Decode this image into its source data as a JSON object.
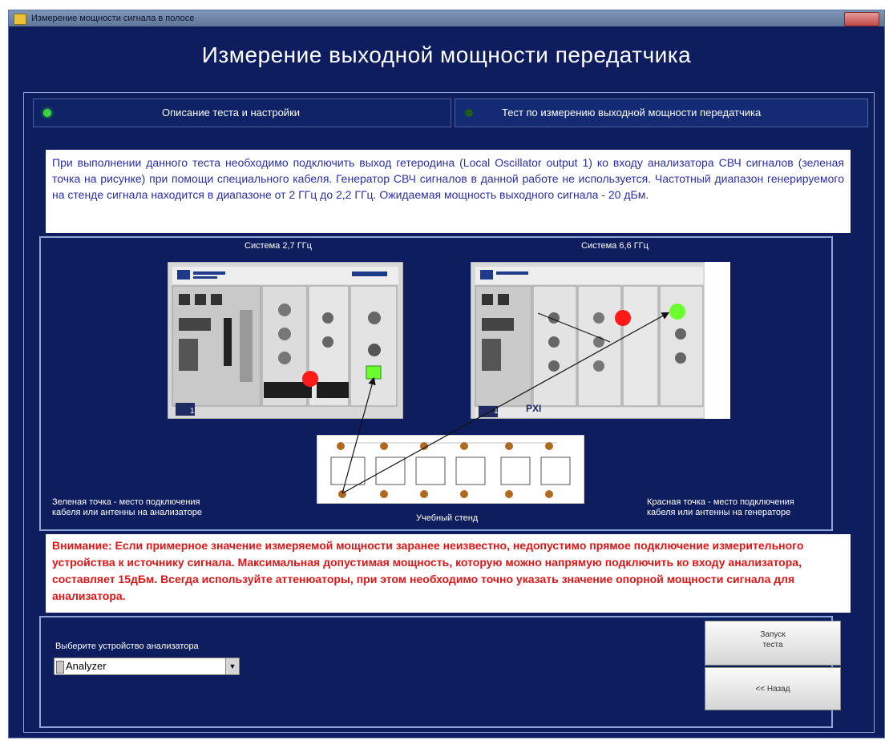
{
  "window": {
    "title": "Измерение мощности сигнала в полосе"
  },
  "header": {
    "title": "Измерение выходной мощности передатчика"
  },
  "tabs": [
    {
      "label": "Описание теста и настройки",
      "active": true
    },
    {
      "label": "Тест по измерению выходной мощности передатчика",
      "active": false
    }
  ],
  "description": "При выполнении данного теста необходимо подключить выход гетеродина (Local Oscillator output 1) ко входу анализатора СВЧ сигналов (зеленая точка на рисунке) при помощи специального кабеля. Генератор СВЧ сигналов в данной работе не используется. Частотный диапазон генерируемого на стенде сигнала находится в диапазоне от 2 ГГц до 2,2 ГГц. Ожидаемая мощность выходного сигнала - 20 дБм.",
  "figure": {
    "system1_label": "Система 2,7 ГГц",
    "system2_label": "Система 6,6 ГГц",
    "green_caption_line1": "Зеленая точка - место подключения",
    "green_caption_line2": "кабеля или антенны на анализаторе",
    "stand_caption": "Учебный стенд",
    "red_caption_line1": "Красная точка - место подключения",
    "red_caption_line2": "кабеля или антенны на генераторе",
    "chassis_badge": "1",
    "pxi_label": "PXI"
  },
  "warning": "Внимание: Если примерное значение измеряемой мощности заранее неизвестно, недопустимо прямое подключение измерительного устройства к источнику сигнала. Максимальная допустимая мощность, которую можно напрямую подключить ко входу анализатора, составляет 15дБм. Всегда используйте аттенюаторы, при этом необходимо точно указать значение опорной мощности сигнала для анализатора.",
  "controls": {
    "analyzer_label": "Выберите устройство анализатора",
    "analyzer_value": "Analyzer",
    "start_line1": "Запуск",
    "start_line2": "теста",
    "back_label": "<< Назад"
  },
  "colors": {
    "background": "#0d1d5e",
    "warning_text": "#e01515",
    "description_text": "#2b2ea8",
    "green_dot": "#6bff2e",
    "red_dot": "#ff1a1a"
  }
}
